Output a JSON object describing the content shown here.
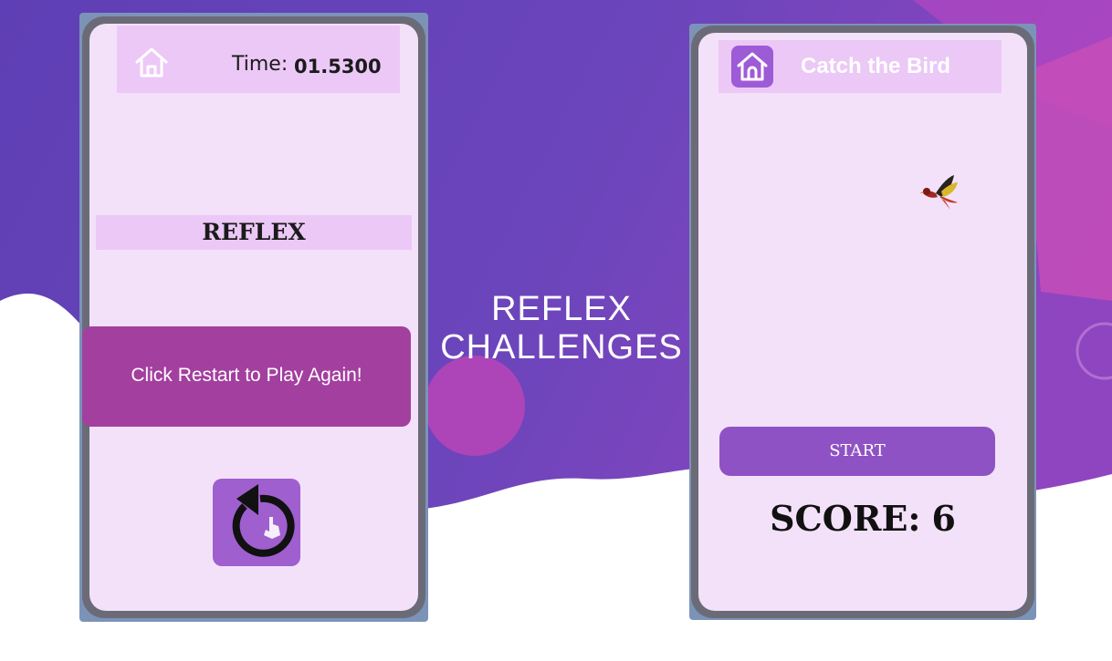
{
  "slide": {
    "heading_line1": "REFLEX",
    "heading_line2": "CHALLENGES"
  },
  "left_phone": {
    "top_bar": {
      "home_icon": "home-outline-icon",
      "time_label": "Time:",
      "time_value": "01.5300"
    },
    "game_title": "REFLEX",
    "banner_text": "Click Restart to Play Again!",
    "restart_icon": "restart-icon"
  },
  "right_phone": {
    "top_bar": {
      "home_icon": "home-icon",
      "title": "Catch the Bird"
    },
    "bird_icon": "bird-icon",
    "start_label": "START",
    "score_label": "SCORE:",
    "score_value": "6"
  },
  "colors": {
    "bg_purple": "#6a45b8",
    "bg_magenta": "#c040b0",
    "screen": "#f3e1f9",
    "bar": "#ecc8f7",
    "banner": "#a33f9e",
    "button_purple": "#8f52c4"
  }
}
